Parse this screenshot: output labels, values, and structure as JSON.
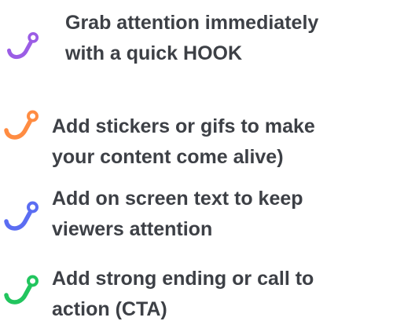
{
  "tips": [
    {
      "icon": "fishing-hook-icon",
      "color": "#9b5de5",
      "lines": [
        "Grab attention immediately",
        "with a quick HOOK"
      ]
    },
    {
      "icon": "fishing-hook-icon",
      "color": "#ff8c42",
      "lines": [
        "Add stickers or gifs to make",
        "your content come alive)"
      ]
    },
    {
      "icon": "fishing-hook-icon",
      "color": "#5b6df2",
      "lines": [
        "Add on screen text to keep",
        "viewers attention"
      ]
    },
    {
      "icon": "fishing-hook-icon",
      "color": "#22c55e",
      "lines": [
        "Add strong ending or call to",
        "action (CTA)"
      ]
    }
  ]
}
